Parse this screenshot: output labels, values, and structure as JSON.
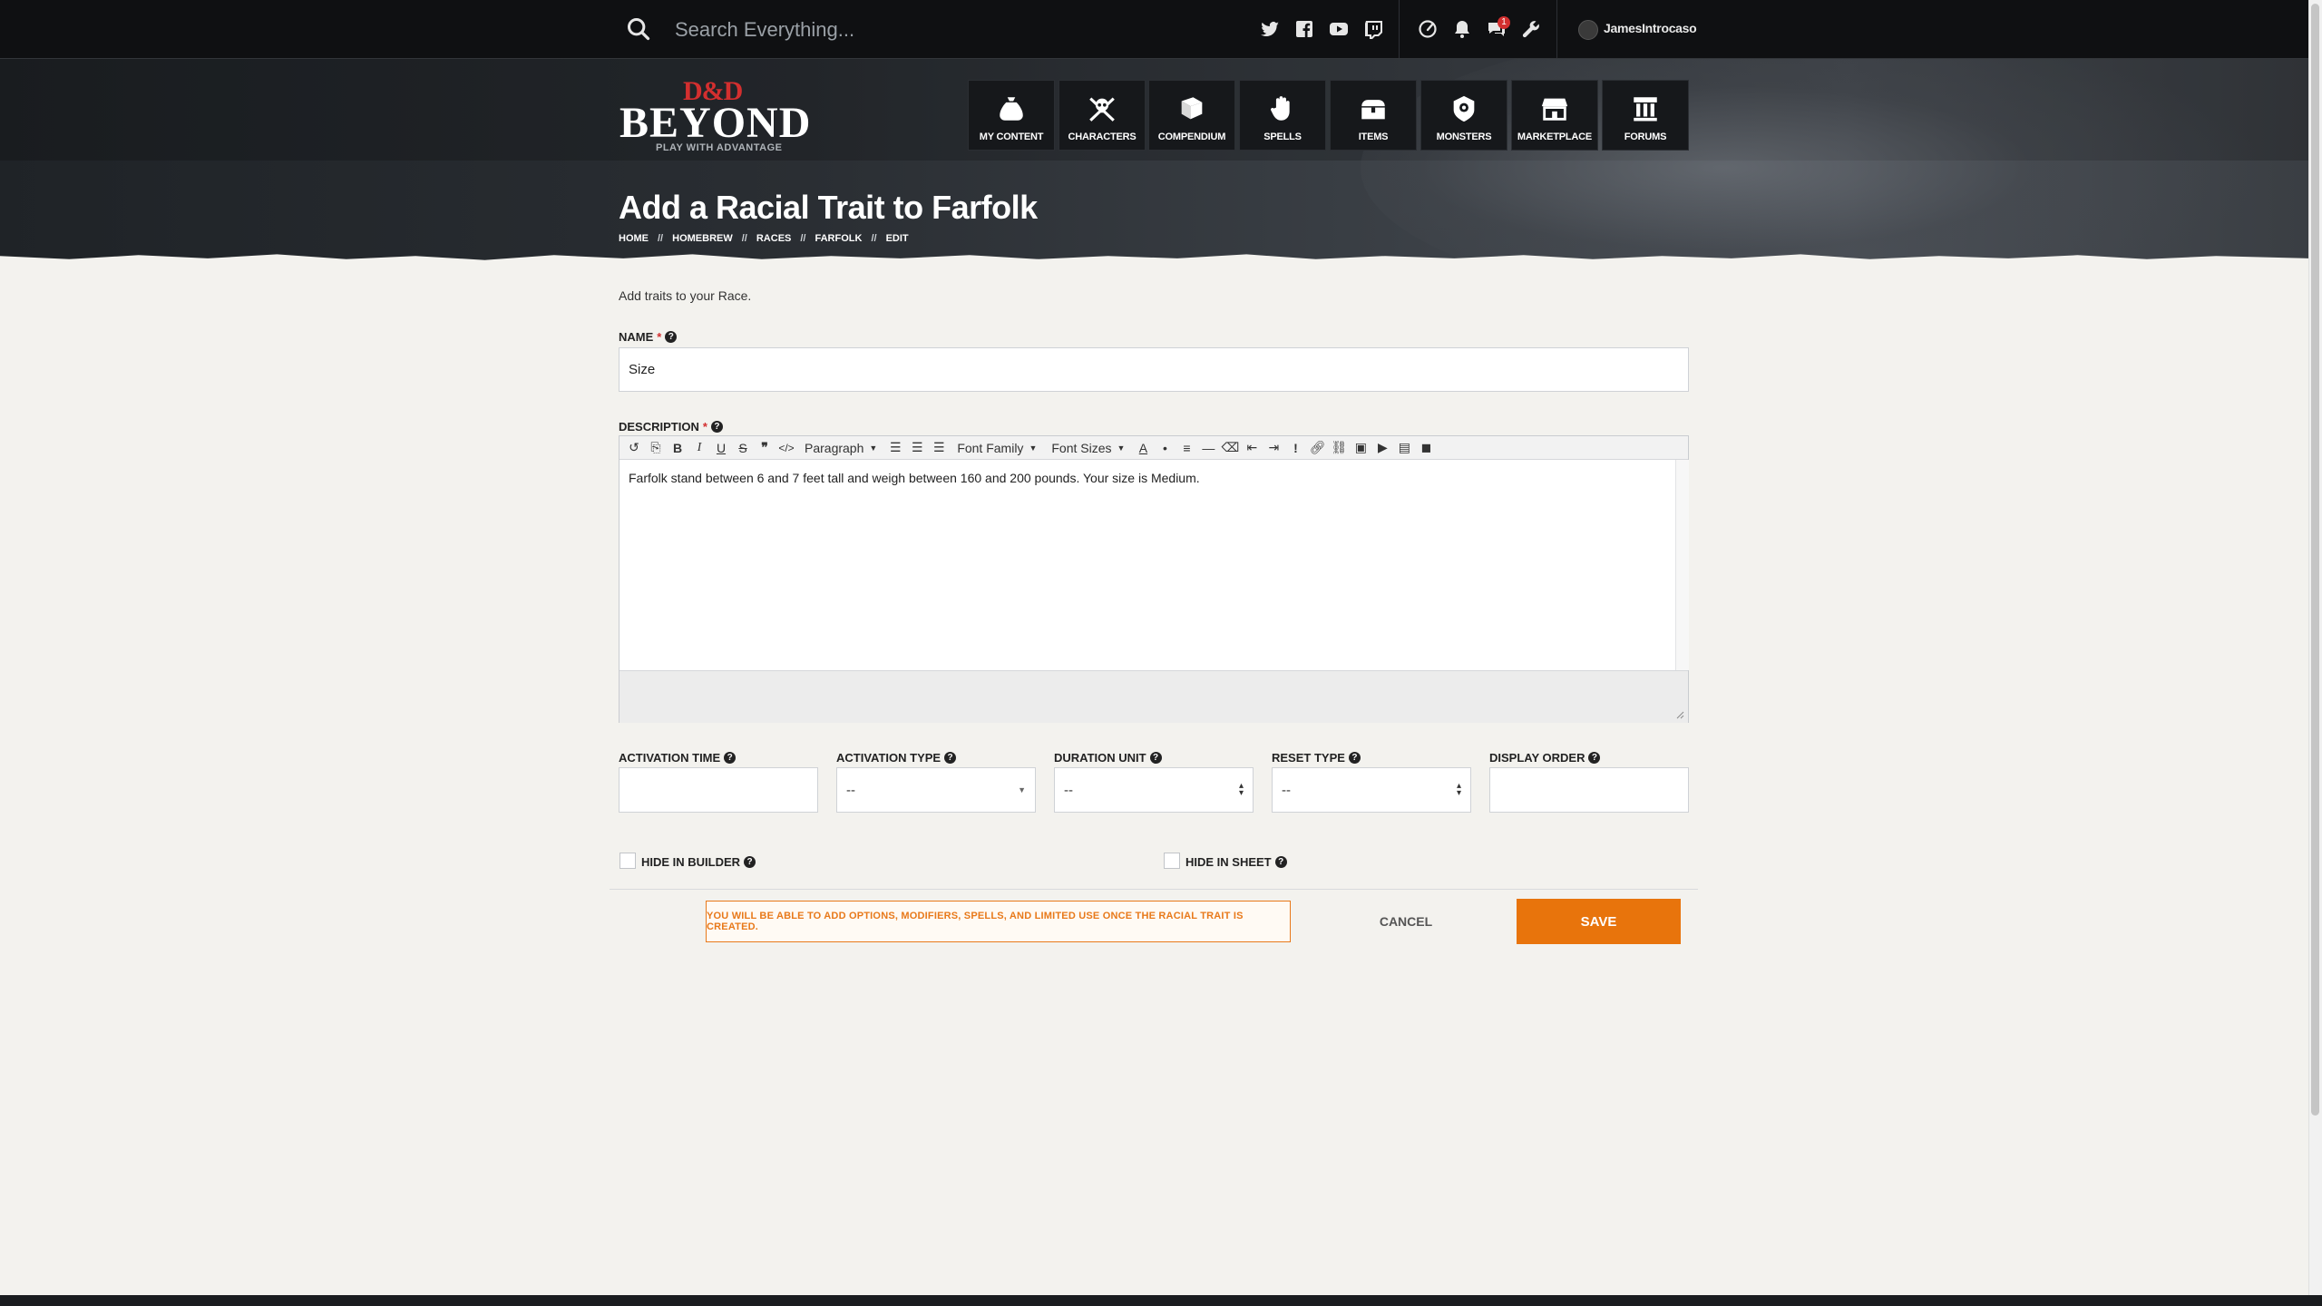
{
  "search": {
    "placeholder": "Search Everything..."
  },
  "topbar": {
    "social_icons": [
      "twitter-icon",
      "facebook-icon",
      "youtube-icon",
      "twitch-icon"
    ],
    "util_icons": [
      "speedometer-icon",
      "bell-icon",
      "chat-icon",
      "wrench-icon"
    ],
    "notification_count": "1",
    "username": "JamesIntrocaso"
  },
  "logo": {
    "dnd": "D&D",
    "beyond": "BEYOND",
    "tagline": "PLAY WITH ADVANTAGE"
  },
  "nav": {
    "items": [
      {
        "label": "MY CONTENT",
        "icon": "bag-icon"
      },
      {
        "label": "CHARACTERS",
        "icon": "skull-crossbones-icon"
      },
      {
        "label": "COMPENDIUM",
        "icon": "book-icon"
      },
      {
        "label": "SPELLS",
        "icon": "hand-icon"
      },
      {
        "label": "ITEMS",
        "icon": "chest-icon"
      },
      {
        "label": "MONSTERS",
        "icon": "monster-icon"
      },
      {
        "label": "MARKETPLACE",
        "icon": "store-icon"
      },
      {
        "label": "FORUMS",
        "icon": "pillar-icon"
      }
    ]
  },
  "page": {
    "title": "Add a Racial Trait to Farfolk",
    "breadcrumb": [
      "HOME",
      "HOMEBREW",
      "RACES",
      "FARFOLK",
      "EDIT"
    ],
    "breadcrumb_sep": "//",
    "intro": "Add traits to your Race."
  },
  "form": {
    "name_label": "NAME",
    "name_value": "Size",
    "description_label": "DESCRIPTION",
    "required_mark": "*",
    "help_mark": "?",
    "toolbar": {
      "paragraph": "Paragraph",
      "font_family": "Font Family",
      "font_sizes": "Font Sizes"
    },
    "description_value": "Farfolk stand between 6 and 7 feet tall and weigh between 160 and 200 pounds. Your size is Medium.",
    "activation_time_label": "ACTIVATION TIME",
    "activation_type_label": "ACTIVATION TYPE",
    "activation_type_value": "--",
    "duration_unit_label": "DURATION UNIT",
    "duration_unit_value": "--",
    "reset_type_label": "RESET TYPE",
    "reset_type_value": "--",
    "display_order_label": "DISPLAY ORDER",
    "hide_builder_label": "HIDE IN BUILDER",
    "hide_sheet_label": "HIDE IN SHEET",
    "notice": "YOU WILL BE ABLE TO ADD OPTIONS, MODIFIERS, SPELLS, AND LIMITED USE ONCE THE RACIAL TRAIT IS CREATED.",
    "cancel_label": "CANCEL",
    "save_label": "SAVE"
  },
  "colors": {
    "accent": "#e8740c",
    "brand_red": "#d32f2f",
    "topbar": "#0f1012"
  }
}
